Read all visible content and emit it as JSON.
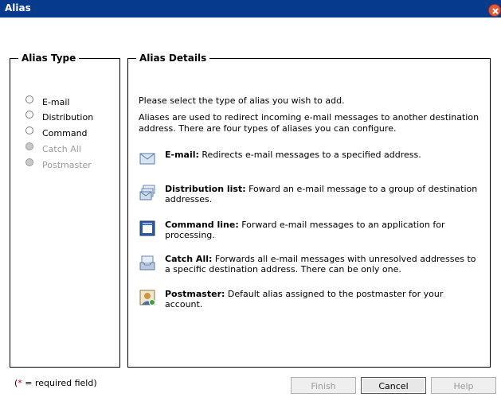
{
  "window": {
    "title": "Alias"
  },
  "alias_type": {
    "legend": "Alias Type",
    "options": [
      {
        "label": "E-mail",
        "enabled": true
      },
      {
        "label": "Distribution",
        "enabled": true
      },
      {
        "label": "Command",
        "enabled": true
      },
      {
        "label": "Catch All",
        "enabled": false
      },
      {
        "label": "Postmaster",
        "enabled": false
      }
    ]
  },
  "alias_details": {
    "legend": "Alias Details",
    "intro": "Please select the type of alias you wish to add.",
    "description": "Aliases are used to redirect incoming e-mail messages to another destination address. There are four types of aliases you can configure.",
    "items": [
      {
        "title": "E-mail:",
        "text": " Redirects e-mail messages to a specified address.",
        "icon": "envelope-icon"
      },
      {
        "title": "Distribution list:",
        "text": " Foward an e-mail message to a group of destination addresses.",
        "icon": "stacked-envelopes-icon"
      },
      {
        "title": "Command line:",
        "text": " Forward e-mail messages to an application for processing.",
        "icon": "command-window-icon"
      },
      {
        "title": "Catch All:",
        "text": " Forwards all e-mail messages with unresolved addresses to a specific destination address. There can be only one.",
        "icon": "catch-all-tray-icon"
      },
      {
        "title": "Postmaster:",
        "text": " Default alias assigned to the postmaster for your account.",
        "icon": "postmaster-user-icon"
      }
    ]
  },
  "footer": {
    "required_star": "*",
    "required_text": " = required field)",
    "required_open": "(",
    "finish": "Finish",
    "cancel": "Cancel",
    "help": "Help"
  },
  "colors": {
    "titlebar": "#063b8c",
    "close": "#e05a3a",
    "required": "#d00000"
  }
}
